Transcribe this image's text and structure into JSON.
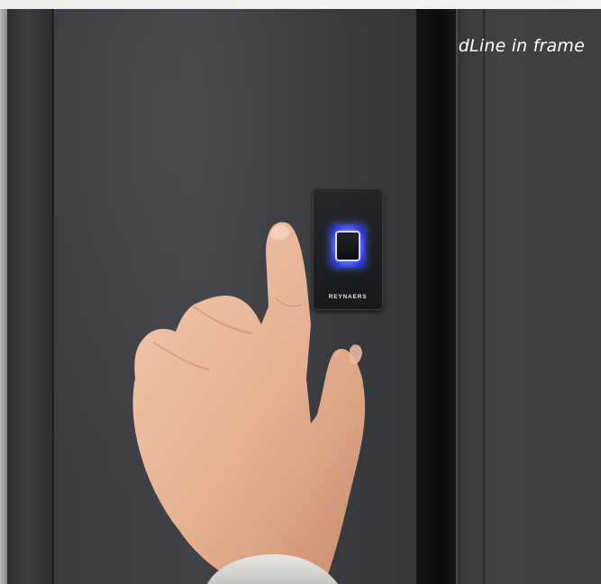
{
  "caption": "dLine in frame",
  "reader": {
    "brand": "REYNAERS"
  },
  "icons": {
    "fingerprint_sensor": "fingerprint-sensor-icon"
  },
  "colors": {
    "door": "#3c3e43",
    "sensor_glow": "#5a6cff",
    "skin": "#e7b79a"
  }
}
